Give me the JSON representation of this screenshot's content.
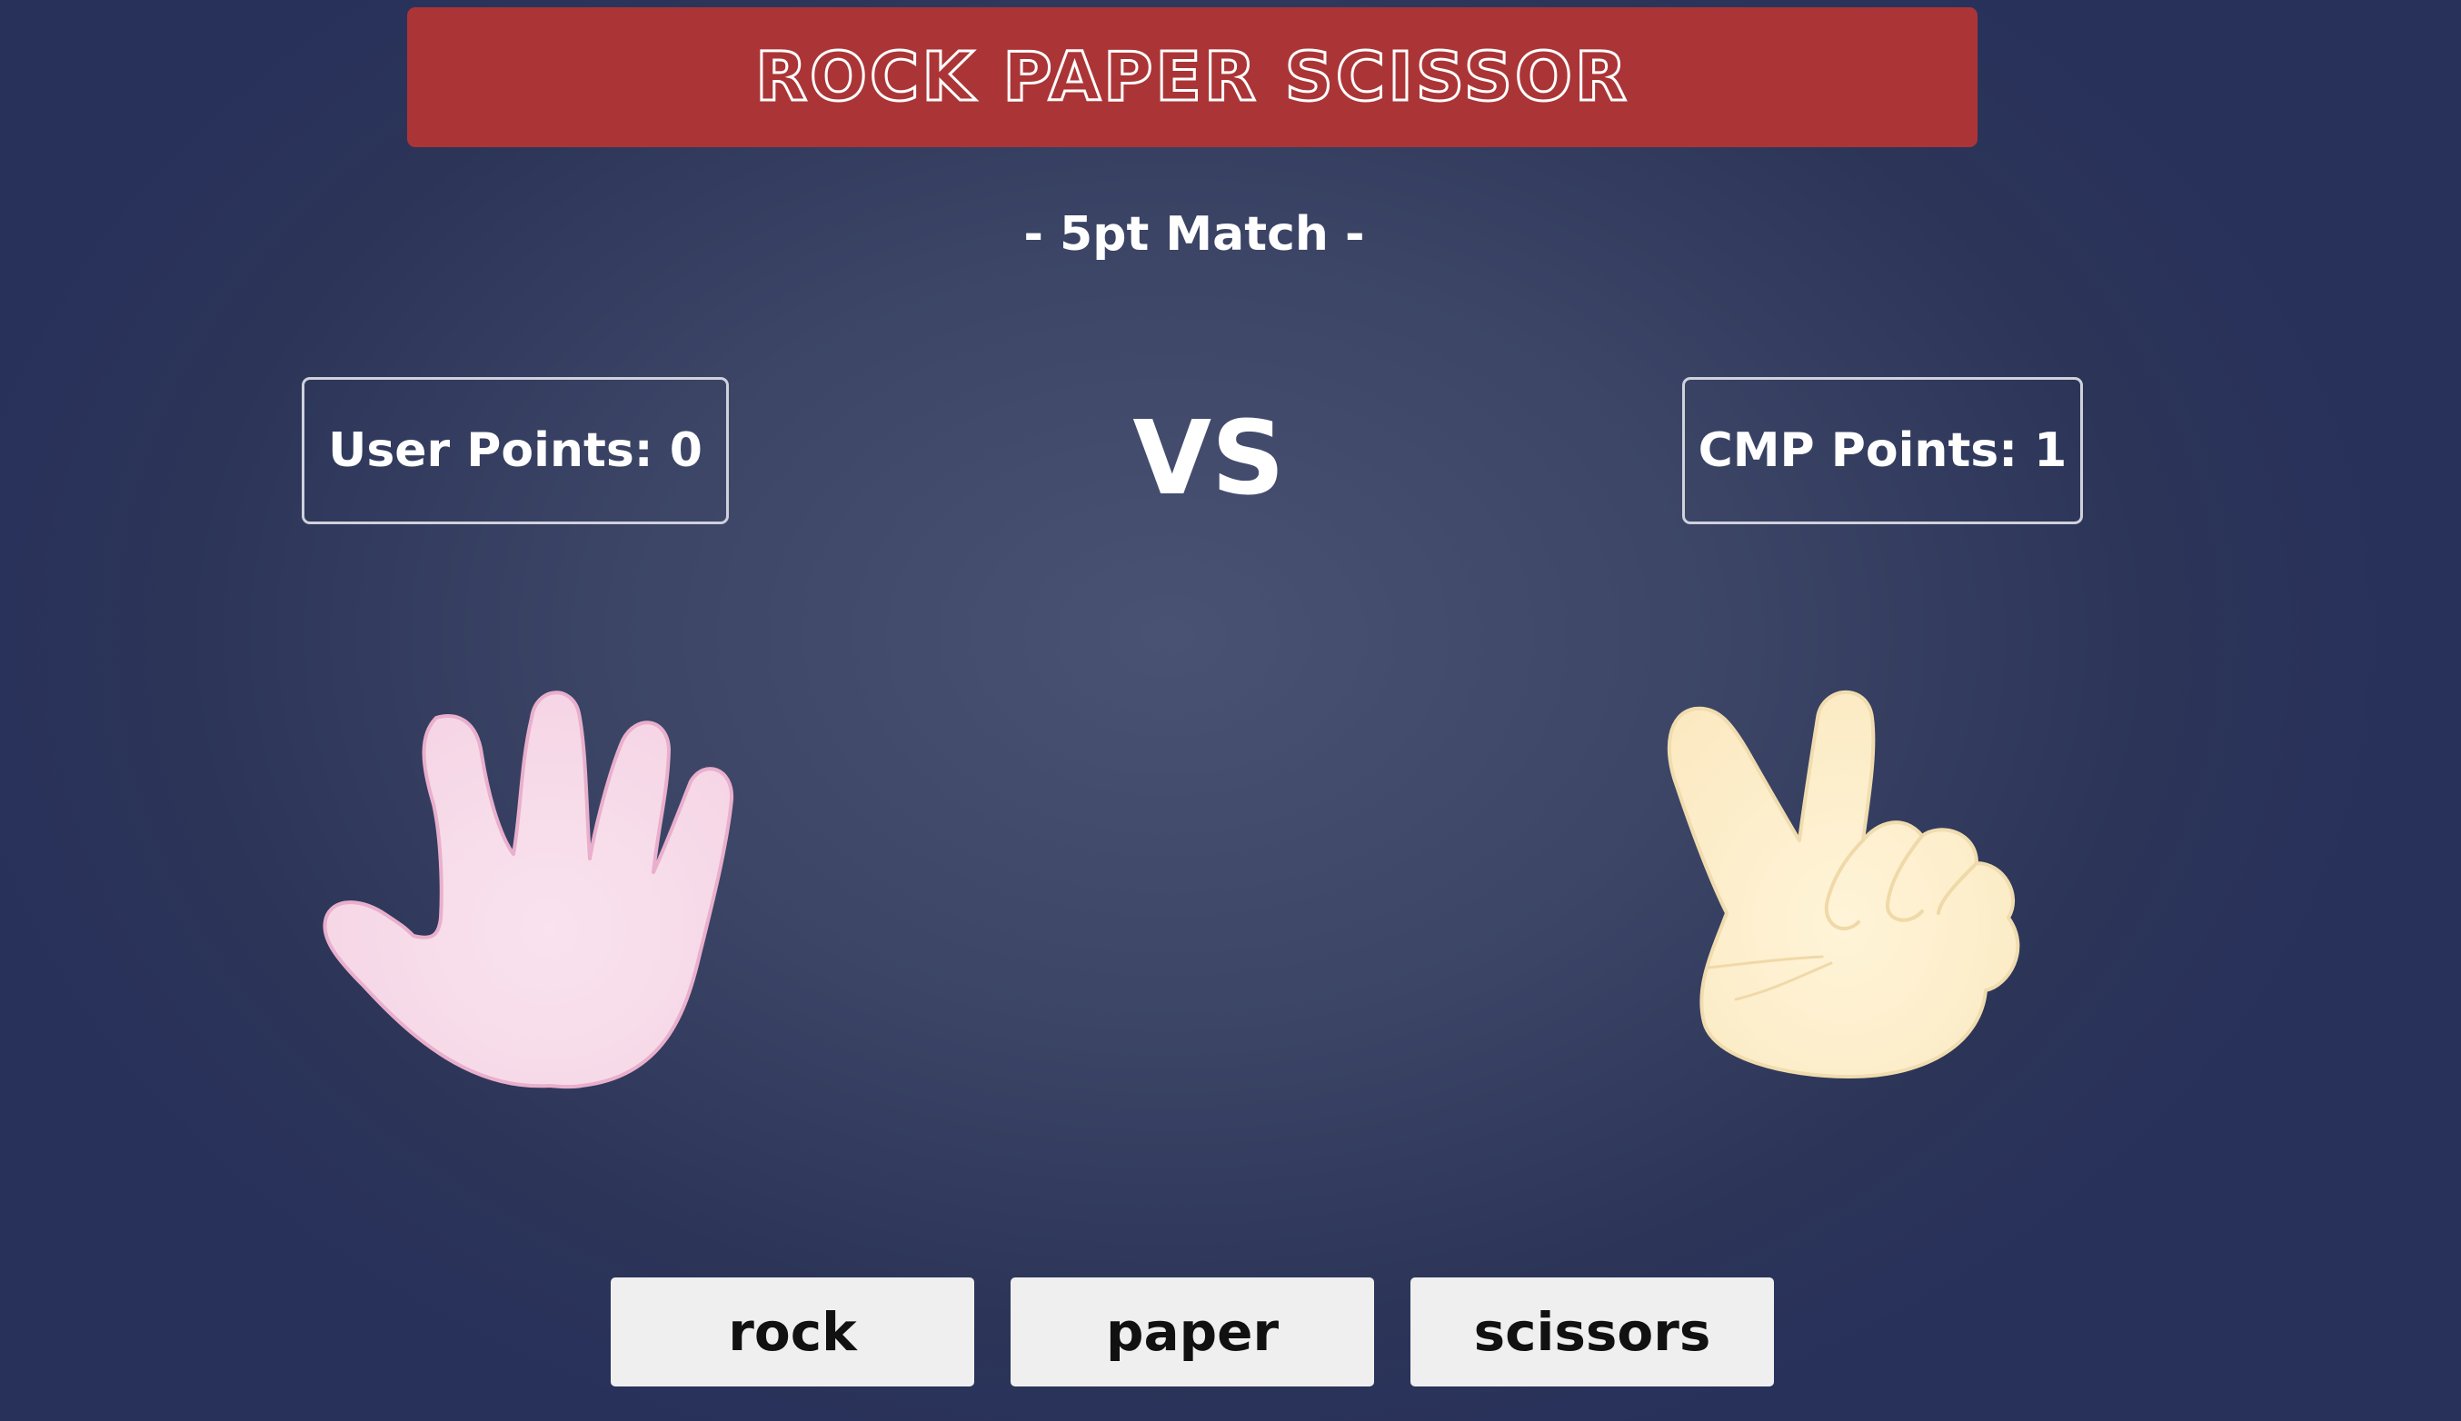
{
  "game": {
    "title": "ROCK PAPER SCISSOR",
    "subtitle": "- 5pt Match -",
    "vs_label": "VS"
  },
  "scores": {
    "user_label": "User Points: 0",
    "cmp_label": "CMP Points: 1",
    "user_points": 0,
    "cmp_points": 1
  },
  "hands": {
    "user_choice": "paper",
    "user_icon": "open-hand-paper-icon",
    "cmp_choice": "scissors",
    "cmp_icon": "peace-hand-scissors-icon"
  },
  "controls": {
    "rock_label": "rock",
    "paper_label": "paper",
    "scissors_label": "scissors"
  },
  "colors": {
    "background": "#3c4566",
    "title_bar": "#ab3536",
    "button_bg": "#efeff0",
    "user_hand": "#f7dbe8",
    "cmp_hand": "#fdefcd"
  }
}
